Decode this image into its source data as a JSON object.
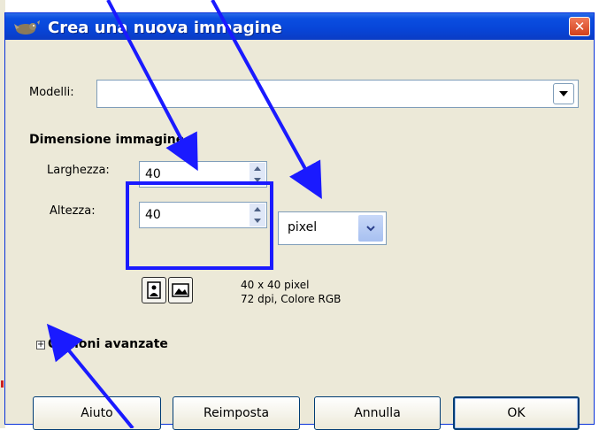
{
  "window": {
    "title": "Crea una nuova immagine",
    "close_glyph": "✕"
  },
  "form": {
    "template_label": "Modelli:",
    "template_value": "",
    "section_title": "Dimensione immagine",
    "width_label": "Larghezza:",
    "width_value": "40",
    "height_label": "Altezza:",
    "height_value": "40",
    "unit_value": "pixel",
    "info_size": "40 x 40 pixel",
    "info_res": "72 dpi, Colore RGB",
    "advanced_label": "Opzioni avanzate",
    "expander_glyph": "+"
  },
  "buttons": {
    "help": "Aiuto",
    "reset": "Reimposta",
    "cancel": "Annulla",
    "ok": "OK"
  },
  "annotation_color": "#1a1aff",
  "icons": [
    "gimp-wilber-icon",
    "close-icon",
    "dropdown-arrow-icon",
    "spin-up-icon",
    "spin-down-icon",
    "portrait-icon",
    "landscape-icon",
    "expander-plus-icon"
  ]
}
